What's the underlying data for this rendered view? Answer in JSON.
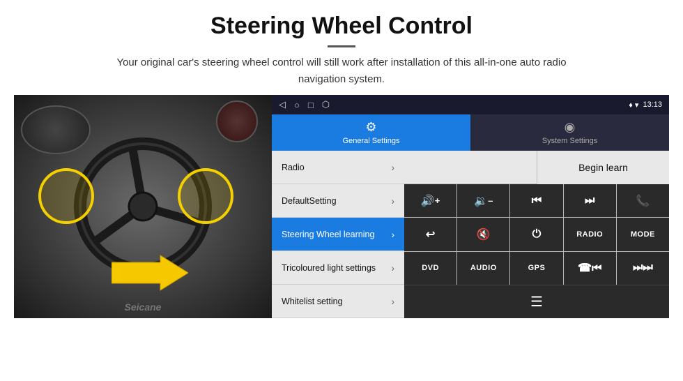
{
  "header": {
    "title": "Steering Wheel Control",
    "subtitle": "Your original car's steering wheel control will still work after installation of this all-in-one auto radio navigation system."
  },
  "status_bar": {
    "nav_icons": [
      "◁",
      "○",
      "□",
      "⬡"
    ],
    "signal": "♦ ▾",
    "time": "13:13"
  },
  "tabs": [
    {
      "id": "general",
      "label": "General Settings",
      "icon": "⚙",
      "active": true
    },
    {
      "id": "system",
      "label": "System Settings",
      "icon": "◉",
      "active": false
    }
  ],
  "menu_items": [
    {
      "id": "radio",
      "label": "Radio",
      "active": false
    },
    {
      "id": "default",
      "label": "DefaultSetting",
      "active": false
    },
    {
      "id": "steering",
      "label": "Steering Wheel learning",
      "active": true
    },
    {
      "id": "tricoloured",
      "label": "Tricoloured light settings",
      "active": false
    },
    {
      "id": "whitelist",
      "label": "Whitelist setting",
      "active": false
    }
  ],
  "buttons": {
    "begin_learn": "Begin learn",
    "controls": [
      {
        "id": "vol-up",
        "icon": "🔊+",
        "label": "🔊+"
      },
      {
        "id": "vol-down",
        "icon": "🔉-",
        "label": "🔉–"
      },
      {
        "id": "prev",
        "icon": "⏮",
        "label": "⏮"
      },
      {
        "id": "next",
        "icon": "⏭",
        "label": "⏭"
      },
      {
        "id": "call",
        "icon": "📞",
        "label": "☎"
      },
      {
        "id": "back",
        "icon": "↩",
        "label": "↩"
      },
      {
        "id": "mute",
        "icon": "🔇",
        "label": "🔇"
      },
      {
        "id": "power",
        "icon": "⏻",
        "label": "⏻"
      },
      {
        "id": "radio-btn",
        "label": "RADIO"
      },
      {
        "id": "mode",
        "label": "MODE"
      },
      {
        "id": "dvd",
        "label": "DVD"
      },
      {
        "id": "audio",
        "label": "AUDIO"
      },
      {
        "id": "gps",
        "label": "GPS"
      },
      {
        "id": "tel-prev",
        "icon": "📞⏮",
        "label": "☎⏮"
      },
      {
        "id": "skip-next",
        "icon": "⏭⏭",
        "label": "⏭⏭"
      }
    ],
    "bottom_icon": "☰"
  },
  "watermark": "Seicane"
}
